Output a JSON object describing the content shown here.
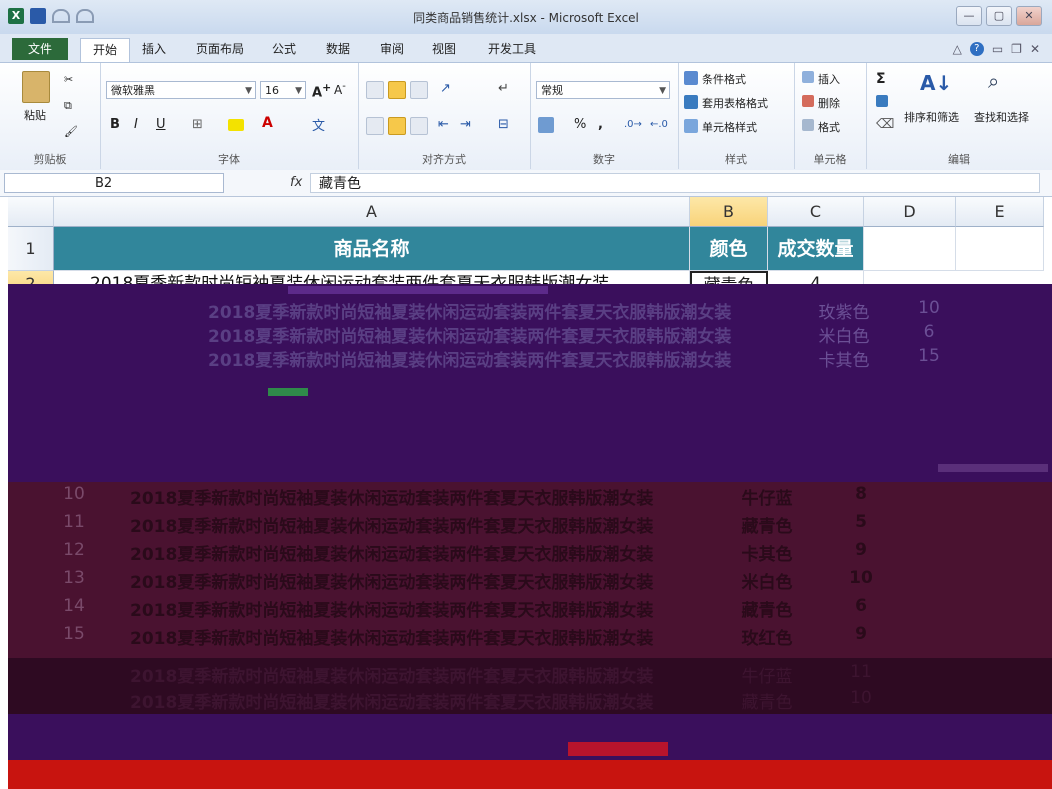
{
  "window": {
    "title": "同类商品销售统计.xlsx - Microsoft Excel",
    "buttons": {
      "minimize": "—",
      "maximize": "▢",
      "close": "✕"
    }
  },
  "qat": {
    "app_icon": "X"
  },
  "tabs": {
    "file": "文件",
    "items": [
      "开始",
      "插入",
      "页面布局",
      "公式",
      "数据",
      "审阅",
      "视图",
      "开发工具"
    ]
  },
  "ribbon": {
    "clipboard": {
      "paste": "粘贴",
      "label": "剪贴板"
    },
    "font": {
      "name": "微软雅黑",
      "size": "16",
      "bold": "B",
      "italic": "I",
      "underline": "U",
      "label": "字体"
    },
    "alignment": {
      "label": "对齐方式"
    },
    "number": {
      "format": "常规",
      "percent": "%",
      "comma": ",",
      "label": "数字"
    },
    "styles": {
      "conditional": "条件格式",
      "table": "套用表格格式",
      "cell": "单元格样式",
      "label": "样式"
    },
    "cells": {
      "insert": "插入",
      "delete": "删除",
      "format": "格式",
      "label": "单元格"
    },
    "editing": {
      "sum": "Σ",
      "sort": "排序和筛选",
      "find": "查找和选择",
      "label": "编辑"
    }
  },
  "formula_bar": {
    "name_box": "B2",
    "fx": "fx",
    "content": "藏青色"
  },
  "columns": [
    "A",
    "B",
    "C",
    "D",
    "E"
  ],
  "rows": {
    "row1": "1",
    "row2": "2"
  },
  "table": {
    "headers": [
      "商品名称",
      "颜色",
      "成交数量"
    ],
    "row2": {
      "name": "2018夏季新款时尚短袖夏装休闲运动套装两件套夏天衣服韩版潮女装",
      "color": "藏青色",
      "qty": "4"
    }
  },
  "glitched_rows": {
    "numbers": [
      "10",
      "11",
      "12",
      "13",
      "14",
      "15"
    ],
    "names": [
      "2018夏季新款时尚短袖夏装休闲运动套装两件套夏天衣服韩版潮女装",
      "2018夏季新款时尚短袖夏装休闲运动套装两件套夏天衣服韩版潮女装",
      "2018夏季新款时尚短袖夏装休闲运动套装两件套夏天衣服韩版潮女装",
      "2018夏季新款时尚短袖夏装休闲运动套装两件套夏天衣服韩版潮女装",
      "2018夏季新款时尚短袖夏装休闲运动套装两件套夏天衣服韩版潮女装",
      "2018夏季新款时尚短袖夏装休闲运动套装两件套夏天衣服韩版潮女装"
    ],
    "colors": [
      "牛仔蓝",
      "藏青色",
      "卡其色",
      "米白色",
      "藏青色",
      "玫红色"
    ],
    "qty": [
      "8",
      "5",
      "9",
      "10",
      "6",
      "9"
    ],
    "upper_colors": [
      "玫紫色",
      "米白色",
      "卡其色"
    ],
    "upper_qty": [
      "10",
      "6",
      "15"
    ],
    "lower_colors": [
      "牛仔蓝",
      "藏青色"
    ],
    "lower_qty": [
      "11",
      "10"
    ]
  },
  "colors": {
    "header_bg": "#31869b",
    "glitch_bg": "#3a0f5c",
    "bottom_band": "#c8140f",
    "file_tab": "#2c6a3a"
  }
}
